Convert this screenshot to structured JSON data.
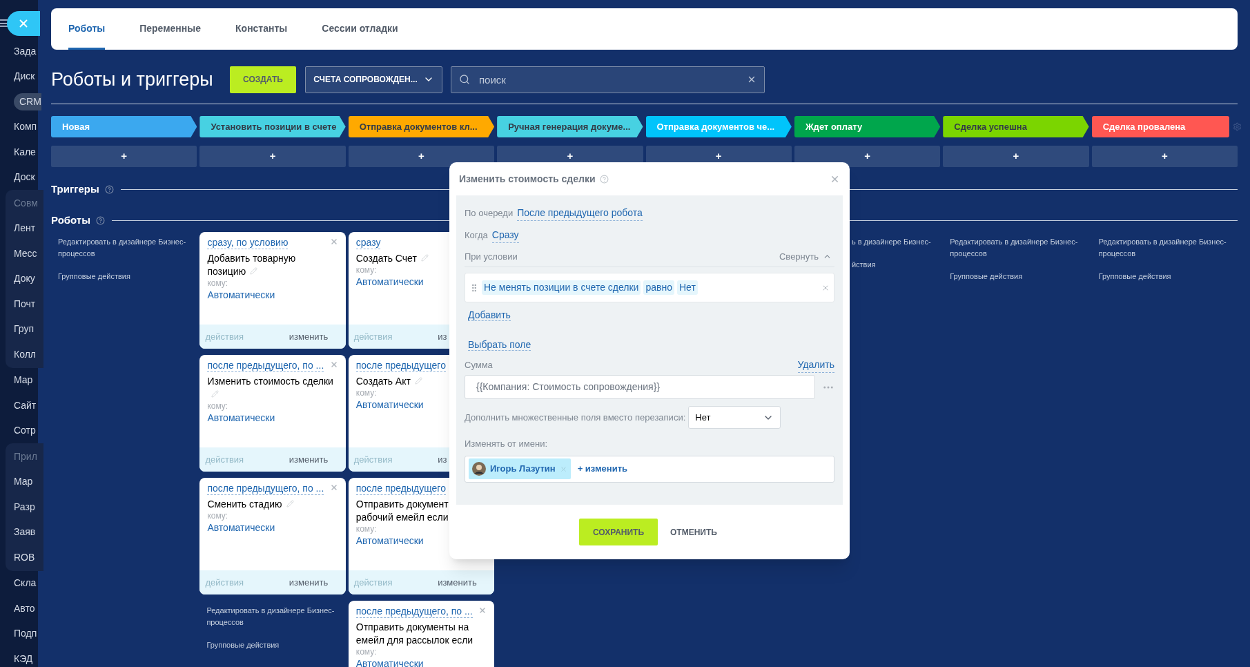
{
  "sidebar": {
    "sections": [
      {
        "grouped": false,
        "items": [
          {
            "text": "Зада",
            "selected": false,
            "kind": "item"
          },
          {
            "text": "Диск",
            "selected": false,
            "kind": "item"
          },
          {
            "text": "CRM",
            "selected": true,
            "kind": "item"
          },
          {
            "text": "Комп",
            "selected": false,
            "kind": "item"
          },
          {
            "text": "Кале",
            "selected": false,
            "kind": "item"
          },
          {
            "text": "Доск",
            "selected": false,
            "kind": "item"
          }
        ]
      },
      {
        "grouped": true,
        "items": [
          {
            "text": "Совм",
            "selected": false,
            "kind": "header"
          },
          {
            "text": "Лент",
            "selected": false,
            "kind": "item"
          },
          {
            "text": "Месс",
            "selected": false,
            "kind": "item"
          },
          {
            "text": "Доку",
            "selected": false,
            "kind": "item"
          },
          {
            "text": "Почт",
            "selected": false,
            "kind": "item"
          },
          {
            "text": "Груп",
            "selected": false,
            "kind": "item"
          },
          {
            "text": "Колл",
            "selected": false,
            "kind": "item"
          }
        ]
      },
      {
        "grouped": false,
        "items": [
          {
            "text": "Мар",
            "selected": false,
            "kind": "item"
          },
          {
            "text": "Сайт",
            "selected": false,
            "kind": "item"
          },
          {
            "text": "Сотр",
            "selected": false,
            "kind": "item"
          }
        ]
      },
      {
        "grouped": true,
        "items": [
          {
            "text": "Прил",
            "selected": false,
            "kind": "header"
          },
          {
            "text": "Мар",
            "selected": false,
            "kind": "item"
          },
          {
            "text": "Разр",
            "selected": false,
            "kind": "item"
          },
          {
            "text": "Заяв",
            "selected": false,
            "kind": "item"
          },
          {
            "text": "ROB",
            "selected": false,
            "kind": "item"
          }
        ]
      },
      {
        "grouped": false,
        "items": [
          {
            "text": "Скла",
            "selected": false,
            "kind": "item"
          },
          {
            "text": "Авто",
            "selected": false,
            "kind": "item"
          },
          {
            "text": "Подп",
            "selected": false,
            "kind": "item"
          },
          {
            "text": "КЭД",
            "selected": false,
            "kind": "item"
          }
        ]
      }
    ]
  },
  "tabs": [
    {
      "label": "Роботы",
      "selected": true
    },
    {
      "label": "Переменные",
      "selected": false
    },
    {
      "label": "Константы",
      "selected": false
    },
    {
      "label": "Сессии отладки",
      "selected": false
    }
  ],
  "header": {
    "title": "Роботы и триггеры",
    "create_button": "СОЗДАТЬ",
    "pipeline": "СЧЕТА СОПРОВОЖДЕН...",
    "search": {
      "placeholder": "поиск"
    }
  },
  "stages": [
    {
      "name": "Новая",
      "color": "#3ba8ef"
    },
    {
      "name": "Установить позиции в счете",
      "color": "#47d1e2"
    },
    {
      "name": "Отправка документов кл...",
      "color": "#ffa900"
    },
    {
      "name": "Ручная генерация докуме...",
      "color": "#47d1e2"
    },
    {
      "name": "Отправка документов че...",
      "color": "#00c4fb"
    },
    {
      "name": "Ждет оплату",
      "color": "#00a64c"
    },
    {
      "name": "Сделка успешна",
      "color": "#7bd500"
    },
    {
      "name": "Сделка провалена",
      "color": "#ff5752"
    }
  ],
  "add_cells": [
    "+",
    "+",
    "+",
    "+",
    "+",
    "+",
    "+",
    "+"
  ],
  "triggers_heading": "Триггеры",
  "robots_heading": "Роботы",
  "robot_columns": [
    {
      "links": [
        "Редактировать в дизайнере Бизнес-процессов",
        "Групповые действия"
      ]
    },
    {
      "cards": [
        {
          "trigger": "сразу, по условию",
          "title_lines": [
            "Добавить товарную",
            "позицию"
          ],
          "editable": true,
          "closable": true,
          "recipient_label": "кому:",
          "recipient": "Автоматически",
          "actions": "действия",
          "change": "изменить"
        },
        {
          "trigger": "после предыдущего, по ...",
          "title_lines": [
            "Изменить стоимость сделки"
          ],
          "editable": true,
          "closable": true,
          "recipient_label": "кому:",
          "recipient": "Автоматически",
          "actions": "действия",
          "change": "изменить"
        },
        {
          "trigger": "после предыдущего, по ...",
          "title_lines": [
            "Сменить стадию"
          ],
          "editable": true,
          "closable": true,
          "recipient_label": "кому:",
          "recipient": "Автоматически",
          "actions": "действия",
          "change": "изменить"
        }
      ],
      "links": [
        "Редактировать в дизайнере Бизнес-процессов",
        "Групповые действия"
      ]
    },
    {
      "cards": [
        {
          "trigger": "сразу",
          "title_lines": [
            "Создать Счет"
          ],
          "editable": true,
          "recipient_label": "кому:",
          "recipient": "Автоматически",
          "actions": "действия",
          "change": "из"
        },
        {
          "trigger": "после предыдущего",
          "title_lines": [
            "Создать Акт"
          ],
          "editable": true,
          "recipient_label": "кому:",
          "recipient": "Автоматически",
          "actions": "действия",
          "change": "из"
        },
        {
          "trigger": "после предыдущего",
          "title_lines": [
            "Отправить документ",
            "рабочий емейл если"
          ],
          "recipient_label": "кому:",
          "recipient": "Автоматически",
          "actions": "действия",
          "change": "изменить"
        },
        {
          "trigger": "после предыдущего, по ...",
          "title_lines": [
            "Отправить документы на",
            "емейл для рассылок если"
          ],
          "editable": false,
          "closable": true,
          "recipient_label": "кому:",
          "recipient": "Автоматически"
        }
      ]
    },
    {},
    {},
    {
      "links": [
        "ь в дизайнере Бизнес-",
        "йствия"
      ]
    },
    {
      "links": [
        "Редактировать в дизайнере Бизнес-процессов",
        "Групповые действия"
      ]
    },
    {
      "links": [
        "Редактировать в дизайнере Бизнес-процессов",
        "Групповые действия"
      ]
    }
  ],
  "dialog": {
    "title": "Изменить стоимость сделки",
    "order_label": "По очереди",
    "order_value": "После предыдущего робота",
    "when_label": "Когда",
    "when_value": "Сразу",
    "condition_label": "При условии",
    "collapse": "Свернуть",
    "condition": {
      "field": "Не менять позиции в счете сделки",
      "operator": "равно",
      "value": "Нет"
    },
    "add_link": "Добавить",
    "choose_field": "Выбрать поле",
    "field_label": "Сумма",
    "delete_link": "Удалить",
    "field_value": "{{Компания: Стоимость сопровождения}}",
    "append_label": "Дополнить множественные поля вместо перезаписи:",
    "append_value": "Нет",
    "author_label": "Изменять от имени:",
    "author": "Игорь Лазутин",
    "change_link": "+ изменить",
    "buttons": [
      "СОХРАНИТЬ",
      "ОТМЕНИТЬ"
    ]
  }
}
